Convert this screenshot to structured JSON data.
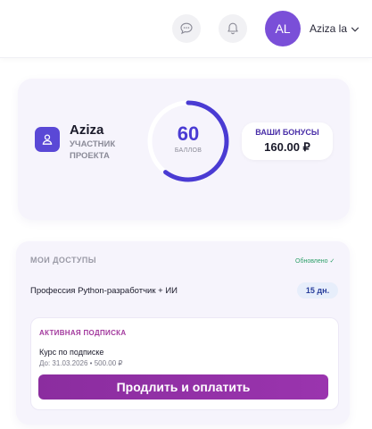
{
  "header": {
    "avatar_initials": "AL",
    "user_name": "Aziza la",
    "icons": [
      "chat-icon",
      "bell-icon",
      "chevron-down-icon"
    ]
  },
  "profile": {
    "name": "Aziza",
    "role": "Участник проекта",
    "score": "60",
    "score_label": "баллов",
    "score_progress_fraction": 0.6,
    "bonus_label": "Ваши бонусы",
    "bonus_value": "160.00 ₽"
  },
  "access": {
    "title": "Мои доступы",
    "updated": "Обновлено ✓",
    "course_name": "Профессия Python-разработчик + ИИ",
    "days_left": "15 дн.",
    "subscription": {
      "title": "Активная подписка",
      "course": "Курс по подписке",
      "until": "До: 31.03.2026 • 500.00 ₽",
      "button_label": "Продлить и оплатить"
    }
  },
  "colors": {
    "accent": "#4a3bd3",
    "avatar": "#7a4fd8",
    "button": "#9131a6",
    "success": "#2fa06a"
  }
}
